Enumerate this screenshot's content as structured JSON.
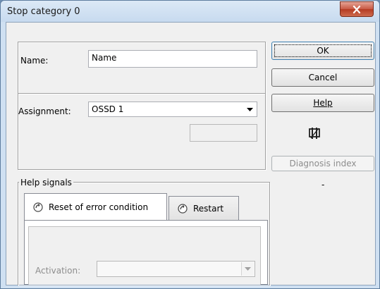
{
  "window": {
    "title": "Stop category 0",
    "close_icon": "close-x-icon"
  },
  "form": {
    "name_label": "Name:",
    "name_value": "Name",
    "assignment_label": "Assignment:",
    "assignment_value": "OSSD 1",
    "assignment_secondary_value": ""
  },
  "buttons": {
    "ok": "OK",
    "cancel": "Cancel",
    "help_label": "Help",
    "diagnosis_label": "Diagnosis index",
    "diagnosis_value": "-"
  },
  "help_signals": {
    "group_label": "Help signals",
    "tabs": [
      {
        "label": "Reset of error condition",
        "icon": "signal-icon",
        "active": true
      },
      {
        "label": "Restart",
        "icon": "signal-icon",
        "active": false
      }
    ],
    "activation_label": "Activation:",
    "activation_value": ""
  },
  "icons": {
    "stop_symbol": "stop-category-icon"
  }
}
